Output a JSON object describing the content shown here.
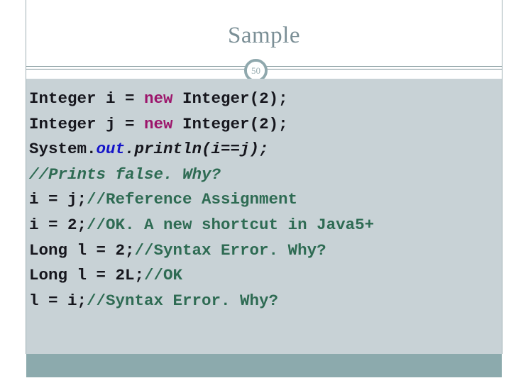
{
  "slide": {
    "title": "Sample",
    "slide_number": "50",
    "colors": {
      "title_text": "#7b8f96",
      "divider": "#7d9499",
      "badge_ring": "#8fa8ad",
      "code_background": "#c8d2d6",
      "footer_bar": "#8caaad",
      "code_plain": "#16161d",
      "code_keyword": "#9c156b",
      "code_field": "#1414c8",
      "code_comment": "#2e6b53"
    }
  },
  "code": {
    "lines": [
      {
        "id": "line-1",
        "tokens": [
          {
            "text": "Integer i = ",
            "style": "plain"
          },
          {
            "text": "new",
            "style": "keyword"
          },
          {
            "text": " Integer(2);",
            "style": "plain"
          }
        ]
      },
      {
        "id": "line-2",
        "tokens": [
          {
            "text": "Integer j = ",
            "style": "plain"
          },
          {
            "text": "new",
            "style": "keyword"
          },
          {
            "text": " Integer(2);",
            "style": "plain"
          }
        ]
      },
      {
        "id": "line-3",
        "tokens": [
          {
            "text": "System.",
            "style": "plain"
          },
          {
            "text": "out",
            "style": "field"
          },
          {
            "text": ".println(i==j);",
            "style": "italic"
          }
        ]
      },
      {
        "id": "line-4",
        "tokens": [
          {
            "text": "//Prints false. Why?",
            "style": "comment-italic"
          }
        ]
      },
      {
        "id": "line-5",
        "tokens": [
          {
            "text": "i = j;",
            "style": "plain"
          },
          {
            "text": "//Reference Assignment",
            "style": "comment"
          }
        ]
      },
      {
        "id": "line-6",
        "tokens": [
          {
            "text": "i = 2;",
            "style": "plain"
          },
          {
            "text": "//OK. A new shortcut in Java5+",
            "style": "comment"
          }
        ]
      },
      {
        "id": "line-7",
        "tokens": [
          {
            "text": "Long l = 2;",
            "style": "plain"
          },
          {
            "text": "//Syntax Error. Why?",
            "style": "comment"
          }
        ]
      },
      {
        "id": "line-8",
        "tokens": [
          {
            "text": "Long l = 2L;",
            "style": "plain"
          },
          {
            "text": "//OK",
            "style": "comment"
          }
        ]
      },
      {
        "id": "line-9",
        "tokens": [
          {
            "text": "l = i;",
            "style": "plain"
          },
          {
            "text": "//Syntax Error. Why?",
            "style": "comment"
          }
        ]
      }
    ]
  }
}
